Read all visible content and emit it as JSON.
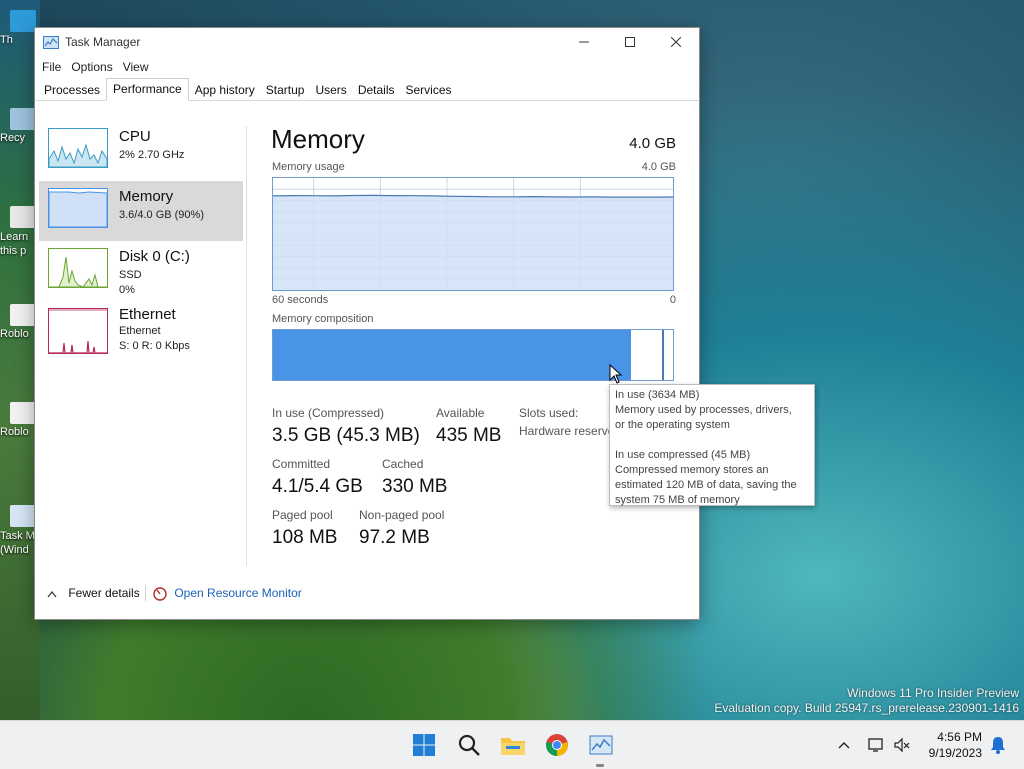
{
  "desktop": {
    "icons": [
      {
        "label": "This PC",
        "short": "Th"
      },
      {
        "label": "Recycle Bin",
        "short": "Recy"
      },
      {
        "label": "Learn about this picture",
        "short": "Learn this p"
      },
      {
        "label": "Roblox Player",
        "short": "Roblo"
      },
      {
        "label": "Roblox Studio",
        "short": "Roblo"
      },
      {
        "label": "Task Manager (Windows)",
        "short": "Task M (Wind"
      }
    ],
    "watermark_line1": "Windows 11 Pro Insider Preview",
    "watermark_line2": "Evaluation copy. Build 25947.rs_prerelease.230901-1416"
  },
  "window": {
    "title": "Task Manager",
    "menu": [
      "File",
      "Options",
      "View"
    ],
    "tabs": [
      "Processes",
      "Performance",
      "App history",
      "Startup",
      "Users",
      "Details",
      "Services"
    ],
    "active_tab": "Performance"
  },
  "sidebar": {
    "items": [
      {
        "name": "CPU",
        "line1": "2% 2.70 GHz",
        "line2": ""
      },
      {
        "name": "Memory",
        "line1": "3.6/4.0 GB (90%)",
        "line2": ""
      },
      {
        "name": "Disk 0 (C:)",
        "line1": "SSD",
        "line2": "0%"
      },
      {
        "name": "Ethernet",
        "line1": "Ethernet",
        "line2": "S: 0 R: 0 Kbps"
      }
    ],
    "selected": "Memory"
  },
  "main": {
    "title": "Memory",
    "total": "4.0 GB",
    "usage_label": "Memory usage",
    "usage_max": "4.0 GB",
    "time_left": "60 seconds",
    "time_right": "0",
    "composition_label": "Memory composition",
    "usage_fraction": 0.9,
    "composition": {
      "in_use_fraction": 0.895,
      "modified_fraction": 0.01,
      "standby_fraction": 0.075
    }
  },
  "stats": {
    "in_use_label": "In use (Compressed)",
    "in_use_value": "3.5 GB (45.3 MB)",
    "available_label": "Available",
    "available_value": "435 MB",
    "slots_label": "Slots used:",
    "hw_reserved_label": "Hardware reserve",
    "committed_label": "Committed",
    "committed_value": "4.1/5.4 GB",
    "cached_label": "Cached",
    "cached_value": "330 MB",
    "paged_label": "Paged pool",
    "paged_value": "108 MB",
    "nonpaged_label": "Non-paged pool",
    "nonpaged_value": "97.2 MB"
  },
  "tooltip": {
    "line1": "In use (3634 MB)",
    "line2": "Memory used by processes, drivers,",
    "line3": "or the operating system",
    "line4": "In use compressed (45 MB)",
    "line5": "Compressed memory stores an",
    "line6": "estimated 120 MB of data, saving the",
    "line7": "system 75 MB of memory"
  },
  "footer": {
    "fewer_details": "Fewer details",
    "resource_monitor": "Open Resource Monitor"
  },
  "taskbar": {
    "time": "4:56 PM",
    "date": "9/19/2023"
  },
  "colors": {
    "memory_accent": "#4a94e8",
    "memory_fill": "#cfe0f7",
    "cpu_accent": "#3a9cc2",
    "disk_accent": "#6aa534",
    "ethernet_accent": "#b5285b",
    "link": "#1a62b7"
  }
}
